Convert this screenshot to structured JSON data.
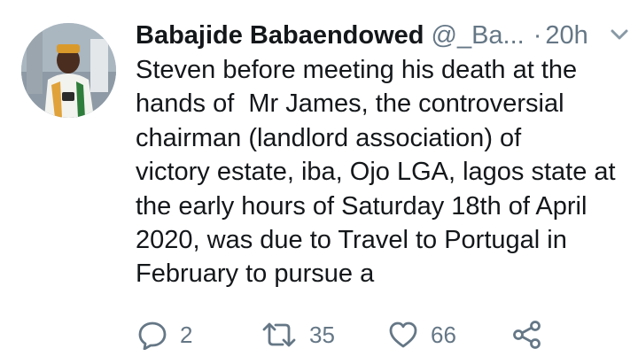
{
  "tweet": {
    "author_name": "Babajide Babaendowed",
    "handle": "@_Ba...",
    "separator": "·",
    "time": "20h",
    "lines": [
      "Steven before meeting his death at the",
      "hands of  Mr James, the controversial",
      "chairman (landlord association) of",
      "victory estate, iba, Ojo LGA, lagos state at",
      "the early hours of Saturday 18th of April",
      "2020, was due to Travel to Portugal in",
      "February to pursue a"
    ]
  },
  "actions": {
    "reply_count": "2",
    "retweet_count": "35",
    "like_count": "66"
  },
  "icons": {
    "reply": "reply-icon",
    "retweet": "retweet-icon",
    "like": "heart-icon",
    "share": "share-icon",
    "menu": "chevron-down-icon"
  },
  "colors": {
    "text": "#14171a",
    "secondary": "#657786"
  }
}
